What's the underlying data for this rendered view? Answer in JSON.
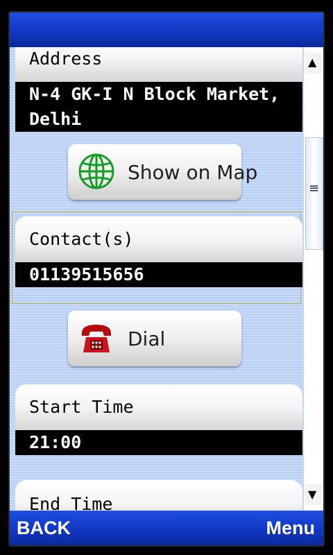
{
  "titlebar": {
    "title": ""
  },
  "fields": [
    {
      "label": "Address",
      "value_lines": [
        "N-4 GK-I N Block Market,",
        "Delhi"
      ]
    },
    {
      "label": "Contact(s)",
      "value_lines": [
        "01139515656"
      ]
    },
    {
      "label": "Start Time",
      "value_lines": [
        "21:00"
      ]
    },
    {
      "label": "End Time",
      "value_lines": []
    }
  ],
  "buttons": {
    "show_on_map": {
      "label": "Show on Map",
      "icon": "globe-icon"
    },
    "dial": {
      "label": "Dial",
      "icon": "telephone-icon"
    }
  },
  "scrollbar": {
    "up_icon": "▲",
    "down_icon": "▼",
    "grip_icon": "≡"
  },
  "softkeys": {
    "left": "BACK",
    "right": "Menu"
  },
  "colors": {
    "bar_blue": "#1238c4",
    "content_bg": "#b9d2f6",
    "focus_border": "#c9a84a"
  }
}
